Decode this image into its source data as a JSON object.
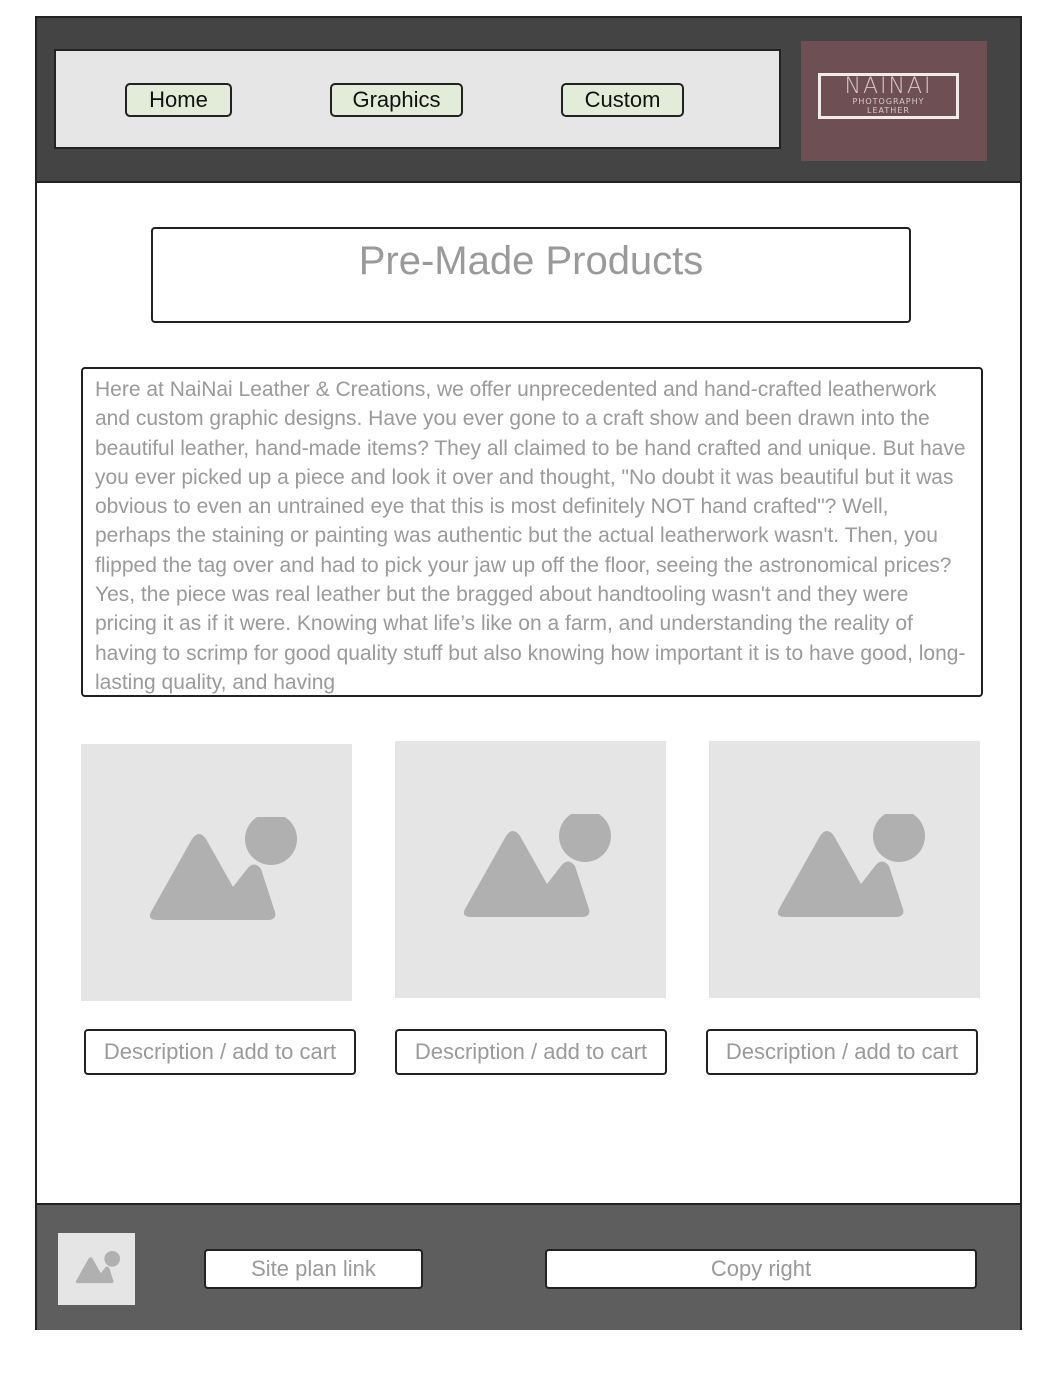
{
  "nav": {
    "items": [
      {
        "label": "Home"
      },
      {
        "label": "Graphics"
      },
      {
        "label": "Custom"
      }
    ]
  },
  "logo": {
    "main": "NAINAI",
    "line1": "PHOTOGRAPHY",
    "line2": "LEATHER",
    "background_color": "#6e5054"
  },
  "main": {
    "title": "Pre-Made Products",
    "intro": "Here at NaiNai Leather & Creations, we offer unprecedented and hand-crafted leatherwork and custom graphic designs. Have you ever gone to a craft show and been drawn into the beautiful leather, hand-made items? They all claimed to be hand crafted and unique. But have you ever picked up a piece and look it over and thought, \"No doubt it was beautiful but it was obvious to even an untrained eye that this is most definitely NOT hand crafted\"? Well, perhaps the staining or painting was authentic but the actual leatherwork wasn't. Then, you flipped the tag over and had to pick your jaw up off the floor, seeing the astronomical prices? Yes, the piece was real leather but the bragged about handtooling wasn't and they were pricing it as if it were. Knowing what life’s like on a farm, and understanding the reality of having to scrimp for good quality stuff but also knowing how important it is to have good, long-lasting quality, and having",
    "products": [
      {
        "image_icon": "image-placeholder-icon",
        "action_label": "Description / add to cart"
      },
      {
        "image_icon": "image-placeholder-icon",
        "action_label": "Description / add to cart"
      },
      {
        "image_icon": "image-placeholder-icon",
        "action_label": "Description / add to cart"
      }
    ]
  },
  "footer": {
    "image_icon": "image-placeholder-icon",
    "site_plan_label": "Site plan link",
    "copyright_label": "Copy right"
  }
}
